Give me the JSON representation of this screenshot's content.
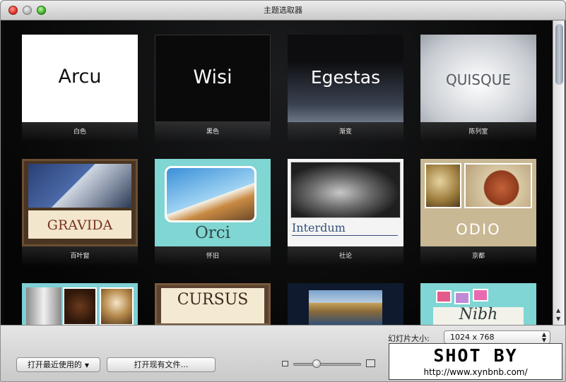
{
  "window": {
    "title": "主题选取器"
  },
  "themes": [
    {
      "title": "Arcu",
      "label": "白色"
    },
    {
      "title": "Wisi",
      "label": "黑色"
    },
    {
      "title": "Egestas",
      "label": "渐变"
    },
    {
      "title": "QUISQUE",
      "label": "陈列室"
    },
    {
      "title": "GRAVIDA",
      "label": "百叶窗"
    },
    {
      "title": "Orci",
      "label": "怀旧"
    },
    {
      "title": "Interdum",
      "label": "社论"
    },
    {
      "title": "ODIO",
      "label": "京都"
    },
    {
      "title": "",
      "label": ""
    },
    {
      "title": "CURSUS",
      "label": ""
    },
    {
      "title": "",
      "label": ""
    },
    {
      "title": "Nibh",
      "label": ""
    }
  ],
  "footer": {
    "slide_size_label": "幻灯片大小:",
    "slide_size_value": "1024 x 768",
    "open_recent": "打开最近使用的",
    "open_existing": "打开现有文件…"
  },
  "watermark": {
    "line1": "SHOT BY",
    "line2": "http://www.xynbnb.com/"
  },
  "colors": {
    "accent": "#3875d7",
    "gallery_bg": "#0b0b0b"
  }
}
